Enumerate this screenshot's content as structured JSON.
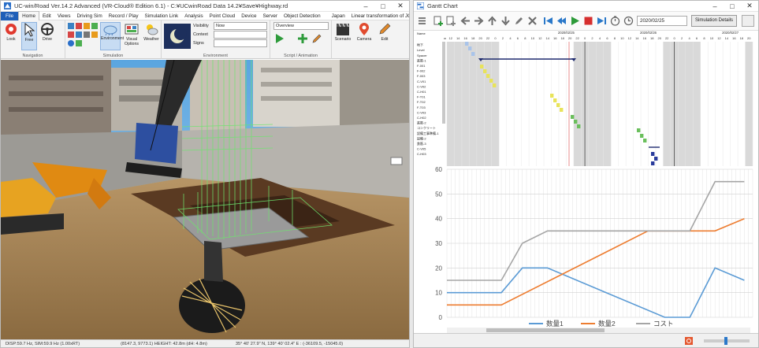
{
  "left_window": {
    "title": "UC-win/Road Ver.14.2 Advanced (VR-Cloud® Edition 6.1) - C:¥UCwinRoad Data 14.2¥Save¥Highway.rd",
    "menu": [
      "File",
      "Home",
      "Edit",
      "Views",
      "Driving Sim",
      "Record / Play",
      "Simulation Link",
      "Analysis",
      "Point Cloud",
      "Device",
      "Server",
      "Object Detection"
    ],
    "menu_extra": [
      "Japan",
      "Linear transformation of JGD2000"
    ],
    "ribbon": {
      "navigation_buttons": [
        "Look",
        "Free",
        "Drive"
      ],
      "simulation_buttons": [
        "Environment",
        "Visual Options",
        "Weather"
      ],
      "env_labels": [
        "Visibility",
        "Context",
        "Signs"
      ],
      "visibility_value": "Now",
      "overview_value": "Overview",
      "script_buttons": [
        "Scenario",
        "Camera",
        "Edit"
      ],
      "groups": [
        "Navigation",
        "Simulation",
        "Environment",
        "Script / Animation"
      ]
    },
    "status": [
      "DISP:59.7 Hz, SIM:59.9 Hz (1.00xRT)",
      "(8147.3, 9773.1)   HEIGHT: 42.8m (dH: 4.8m)",
      "35° 40' 27.9\" N, 139° 40' 02.4\" E  :  (-36109.5, -15045.0)"
    ]
  },
  "right_window": {
    "title": "Gantt Chart",
    "date_value": "2020/02/25",
    "details_button": "Simulation Details",
    "dates_header": [
      "2020/02/25",
      "2020/02/26",
      "2020/02/27"
    ],
    "hours": [
      "12",
      "14",
      "16",
      "18",
      "20",
      "22",
      "0",
      "2",
      "4",
      "6",
      "8",
      "10",
      "12",
      "14",
      "16",
      "18",
      "20",
      "22",
      "0",
      "2",
      "4",
      "6",
      "8",
      "10",
      "12",
      "14",
      "16",
      "18",
      "20",
      "22",
      "0",
      "2",
      "4",
      "6",
      "8",
      "10",
      "12",
      "14",
      "16",
      "18",
      "20"
    ],
    "task_names": [
      "Name",
      "地下",
      "Level",
      "Spacer",
      "鉄筋-1",
      "F-001",
      "F-002",
      "F-003",
      "C-V01",
      "C-V02",
      "C-H01",
      "F-T01",
      "F-T02",
      "F-T03",
      "C-V03",
      "C-H02",
      "鉄筋-2",
      "コンクリート",
      "設備工事準備-1",
      "設備-2",
      "鉄筋-3",
      "C-V05",
      "C-H03"
    ],
    "sun_label": "Sun"
  },
  "chart_data": {
    "type": "line",
    "x": [
      0,
      1,
      2,
      3,
      4,
      5,
      6,
      7,
      8,
      9,
      10,
      11,
      12,
      13,
      14,
      15,
      16,
      17,
      18,
      19,
      20,
      21,
      22,
      23,
      24,
      25,
      26,
      27,
      28,
      29,
      30,
      31,
      32,
      33,
      34,
      35,
      36,
      37,
      38,
      39,
      40,
      41,
      42,
      43,
      44,
      45,
      46,
      47,
      48,
      49,
      50,
      51,
      52,
      53,
      54,
      55,
      56,
      57,
      58,
      59,
      60,
      61,
      62,
      63,
      64,
      65,
      66,
      67,
      68,
      69,
      70,
      71,
      72,
      73
    ],
    "ylim": [
      0,
      60
    ],
    "yticks": [
      0,
      10,
      20,
      30,
      40,
      50,
      60
    ],
    "grid": true,
    "legend_position": "bottom",
    "series": [
      {
        "name": "数量1",
        "color": "#5b9bd5",
        "points": [
          [
            0,
            10
          ],
          [
            13,
            10
          ],
          [
            18,
            20
          ],
          [
            24,
            20
          ],
          [
            52,
            0
          ],
          [
            58,
            0
          ],
          [
            64,
            20
          ],
          [
            71,
            15
          ]
        ]
      },
      {
        "name": "数量2",
        "color": "#ed7d31",
        "points": [
          [
            0,
            5
          ],
          [
            13,
            5
          ],
          [
            48,
            35
          ],
          [
            64,
            35
          ],
          [
            71,
            40
          ]
        ]
      },
      {
        "name": "コスト",
        "color": "#a5a5a5",
        "points": [
          [
            0,
            15
          ],
          [
            13,
            15
          ],
          [
            18,
            30
          ],
          [
            24,
            35
          ],
          [
            58,
            35
          ],
          [
            64,
            55
          ],
          [
            71,
            55
          ]
        ]
      }
    ]
  }
}
